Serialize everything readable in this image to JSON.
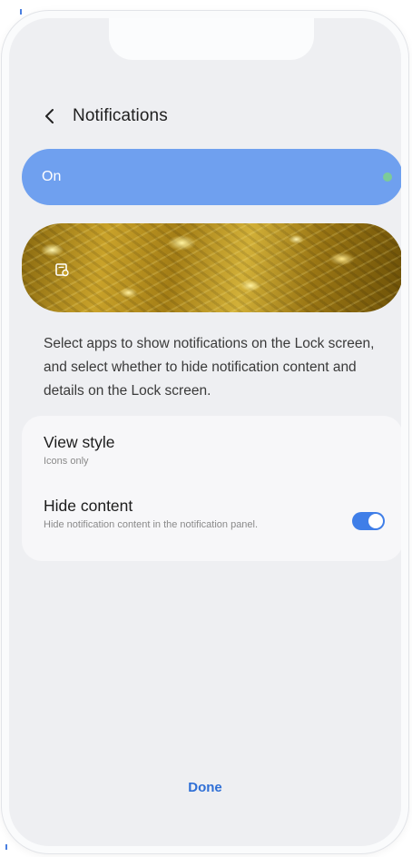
{
  "header": {
    "back_icon": "chevron-left-icon",
    "title": "Notifications"
  },
  "master_switch": {
    "label": "On",
    "state": "on",
    "indicator_color": "#7fd28a",
    "bar_color": "#6fa0ef"
  },
  "preview": {
    "wallpaper": "gold-foil",
    "icon": "lock-screen-notification-icon"
  },
  "description": "Select apps to show notifications on the Lock screen, and select whether to hide notification content and details on the Lock screen.",
  "settings": {
    "view_style": {
      "title": "View style",
      "value": "Icons only"
    },
    "hide_content": {
      "title": "Hide content",
      "subtitle": "Hide notification content in the notification panel.",
      "enabled": true,
      "toggle_color": "#3f7ee8"
    }
  },
  "footer": {
    "done_label": "Done",
    "accent_color": "#2f6fd6"
  }
}
